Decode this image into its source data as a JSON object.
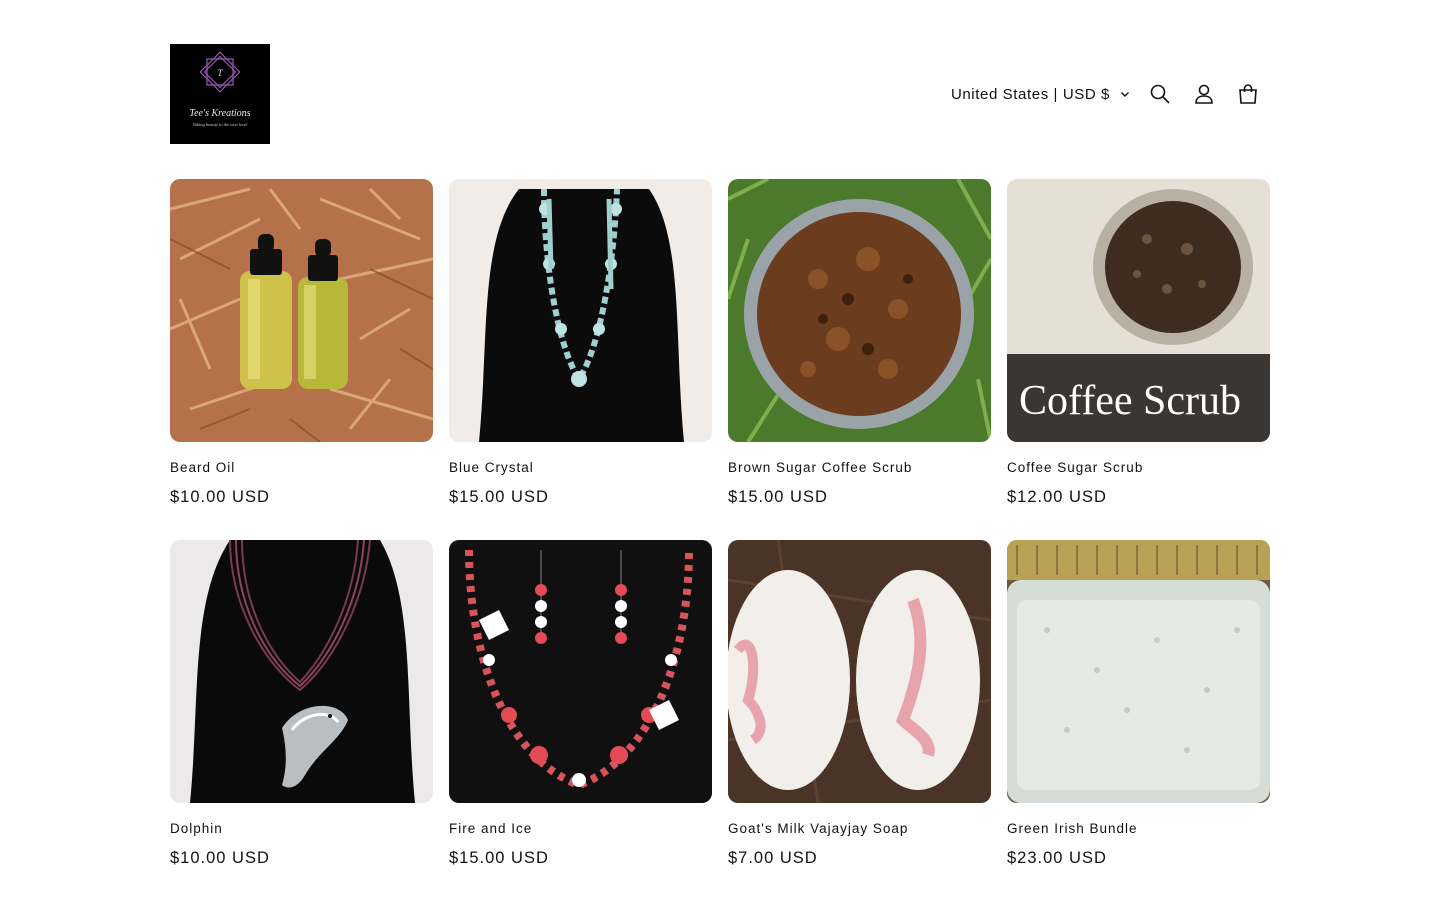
{
  "header": {
    "logo_alt": "Tee's Kreations",
    "logo_text": "Tee's Kreations",
    "logo_tagline": "Taking beauty to the next level",
    "localization": "United States | USD $",
    "icons": [
      "search-icon",
      "account-icon",
      "cart-icon"
    ]
  },
  "colors": {
    "text": "#121212",
    "background": "#ffffff",
    "logo_bg": "#000000",
    "logo_accent": "#8e44ad"
  },
  "products": [
    {
      "title": "Beard Oil",
      "price": "$10.00 USD"
    },
    {
      "title": "Blue Crystal",
      "price": "$15.00 USD"
    },
    {
      "title": "Brown Sugar Coffee Scrub",
      "price": "$15.00 USD"
    },
    {
      "title": "Coffee Sugar Scrub",
      "price": "$12.00 USD",
      "image_caption": "Coffee Scrub"
    },
    {
      "title": "Dolphin",
      "price": "$10.00 USD"
    },
    {
      "title": "Fire and Ice",
      "price": "$15.00 USD"
    },
    {
      "title": "Goat's Milk Vajayjay Soap",
      "price": "$7.00 USD"
    },
    {
      "title": "Green Irish Bundle",
      "price": "$23.00 USD"
    }
  ]
}
